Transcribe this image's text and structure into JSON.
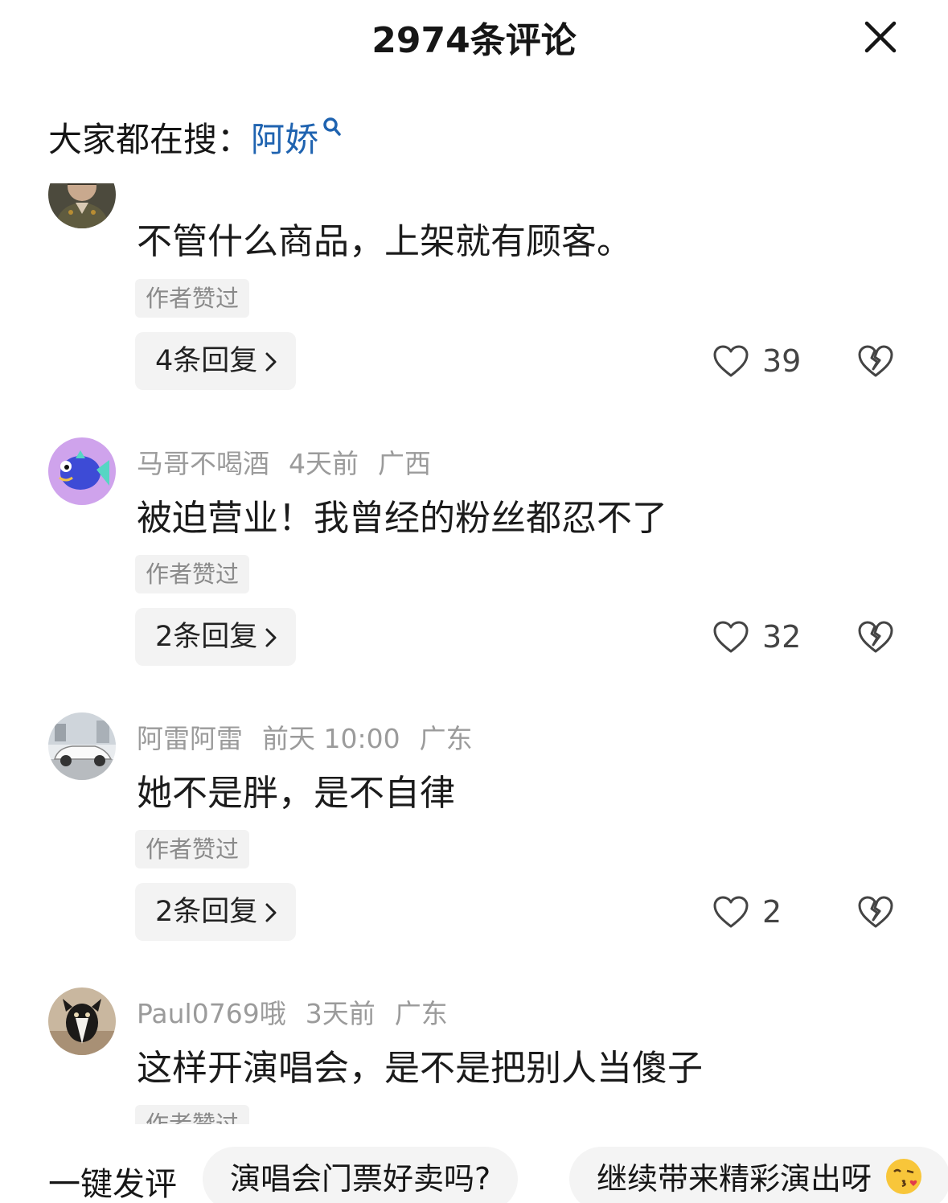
{
  "header": {
    "title": "2974条评论",
    "close_icon": "close-icon"
  },
  "search": {
    "prefix": "大家都在搜：",
    "keyword": "阿娇",
    "icon": "search-icon",
    "link_color": "#1f63b0"
  },
  "comments": [
    {
      "user": "",
      "time": "",
      "location": "",
      "text": "不管什么商品，上架就有顾客。",
      "tag": "作者赞过",
      "replies": "4条回复",
      "likes": "39"
    },
    {
      "user": "马哥不喝酒",
      "time": "4天前",
      "location": "广西",
      "text": "被迫营业！我曾经的粉丝都忍不了",
      "tag": "作者赞过",
      "replies": "2条回复",
      "likes": "32"
    },
    {
      "user": "阿雷阿雷",
      "time": "前天 10:00",
      "location": "广东",
      "text": "她不是胖，是不自律",
      "tag": "作者赞过",
      "replies": "2条回复",
      "likes": "2"
    },
    {
      "user": "Paul0769哦",
      "time": "3天前",
      "location": "广东",
      "text": "这样开演唱会，是不是把别人当傻子",
      "tag": "作者赞过",
      "replies": "",
      "likes": ""
    }
  ],
  "quick_reply": {
    "label": "一键发评",
    "chips": [
      "演唱会门票好卖吗?",
      "继续带来精彩演出呀"
    ],
    "chip_emoji_icon": "kiss-face-emoji-icon"
  }
}
